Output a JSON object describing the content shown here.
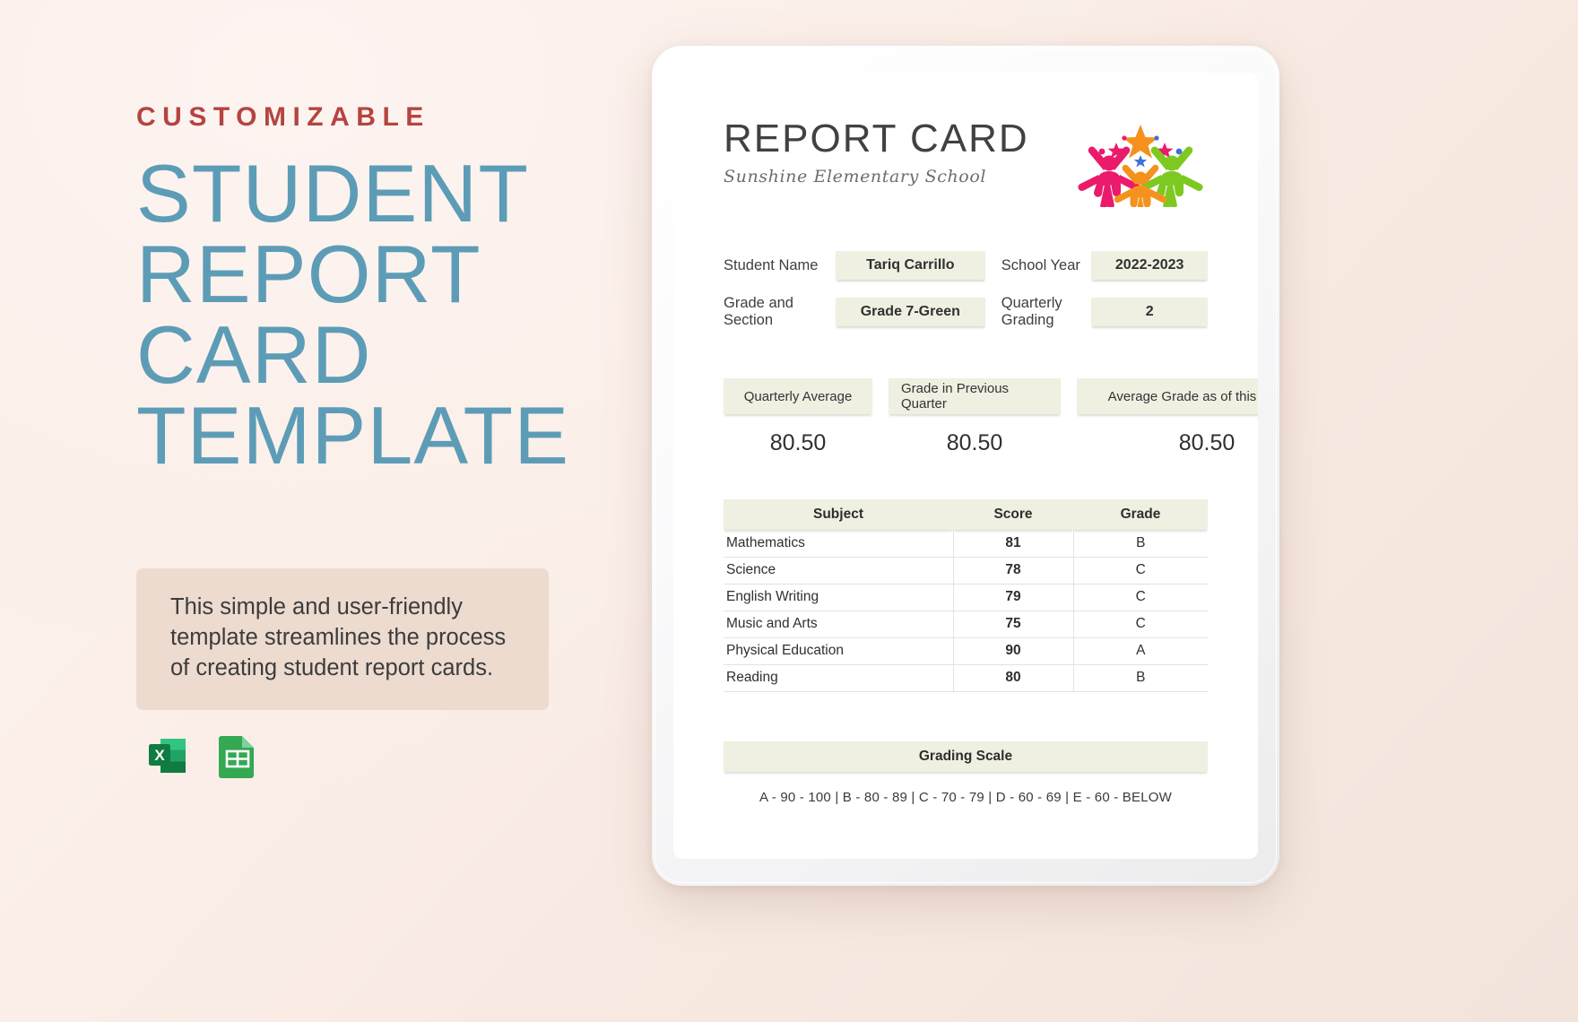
{
  "promo": {
    "kicker": "CUSTOMIZABLE",
    "title_lines": [
      "STUDENT",
      "REPORT",
      "CARD",
      "TEMPLATE"
    ],
    "description": "This simple and user-friendly template streamlines the process of creating student report cards.",
    "formats": [
      {
        "name": "excel-file-icon",
        "label": "X"
      },
      {
        "name": "google-sheets-file-icon",
        "label": ""
      }
    ],
    "colors": {
      "kicker": "#b54440",
      "title": "#5d9cb6",
      "desc_bg": "#eddbd0"
    }
  },
  "report": {
    "title": "REPORT CARD",
    "school": "Sunshine Elementary School",
    "info": [
      {
        "label_left": "Student Name",
        "value_left": "Tariq Carrillo",
        "label_right": "School Year",
        "value_right": "2022-2023"
      },
      {
        "label_left": "Grade and Section",
        "value_left": "Grade 7-Green",
        "label_right": "Quarterly Grading",
        "value_right": "2"
      }
    ],
    "averages": [
      {
        "label": "Quarterly Average",
        "value": "80.50"
      },
      {
        "label": "Grade in Previous Quarter",
        "value": "80.50"
      },
      {
        "label": "Average Grade as of this Quarter",
        "value": "80.50"
      }
    ],
    "table": {
      "headers": [
        "Subject",
        "Score",
        "Grade"
      ],
      "rows": [
        [
          "Mathematics",
          "81",
          "B"
        ],
        [
          "Science",
          "78",
          "C"
        ],
        [
          "English Writing",
          "79",
          "C"
        ],
        [
          "Music and Arts",
          "75",
          "C"
        ],
        [
          "Physical Education",
          "90",
          "A"
        ],
        [
          "Reading",
          "80",
          "B"
        ]
      ]
    },
    "grading_scale": {
      "heading": "Grading Scale",
      "text": "A - 90 - 100 | B - 80 - 89 | C - 70 - 79 | D - 60 - 69 | E - 60 - BELOW"
    },
    "colors": {
      "field_bg": "#eff0e1",
      "text": "#2f2f2f"
    }
  }
}
